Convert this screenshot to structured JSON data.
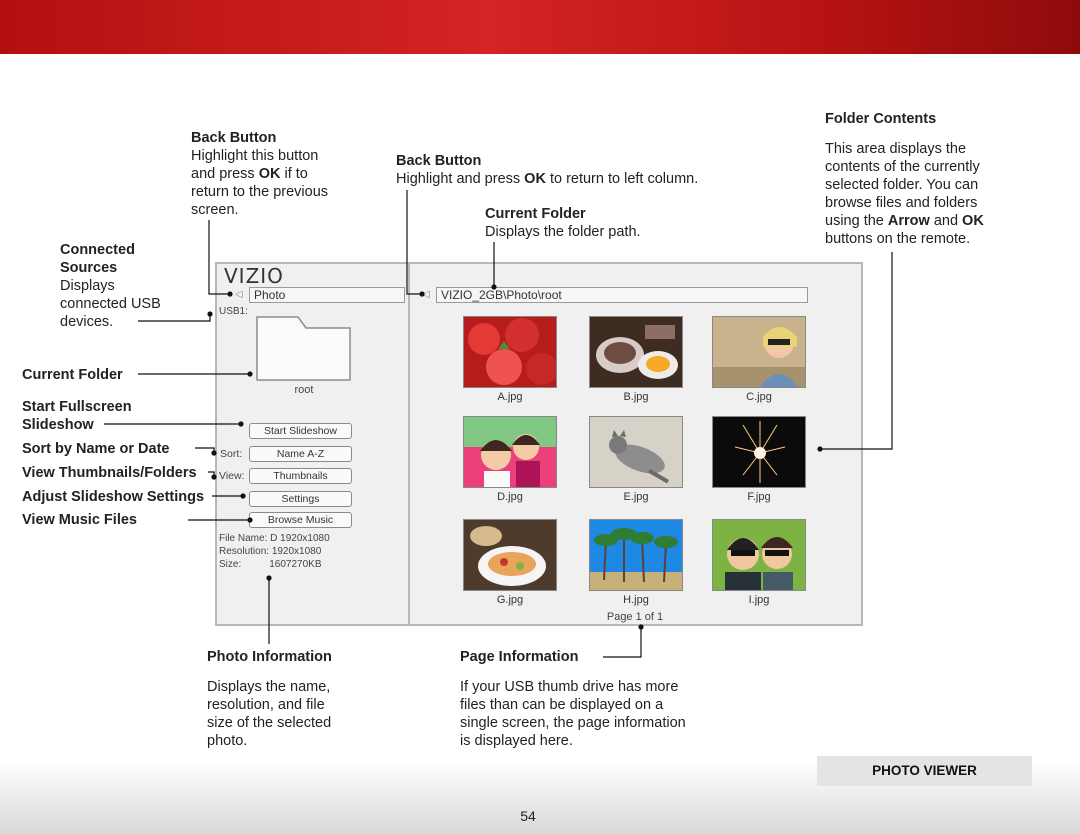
{
  "annotations": {
    "back_left": {
      "title": "Back Button",
      "t1": "Highlight this button",
      "t2a": "and press ",
      "t2b": "OK",
      "t2c": " if to",
      "t3": "return to the previous",
      "t4": "screen."
    },
    "back_right": {
      "title": "Back Button",
      "t1a": "Highlight and press ",
      "t1b": "OK",
      "t1c": " to return to left column."
    },
    "current_folder_right": {
      "title": "Current Folder",
      "t1": "Displays the folder path."
    },
    "folder_contents": {
      "title": "Folder Contents",
      "t1": "This area displays the",
      "t2": "contents of the currently",
      "t3": "selected folder. You can",
      "t4": "browse files and folders",
      "t5a": "using the ",
      "t5b": "Arrow",
      "t5c": " and ",
      "t5d": "OK",
      "t6": "buttons on the remote."
    },
    "connected": {
      "title1": "Connected",
      "title2": "Sources",
      "t1": "Displays",
      "t2": "connected USB",
      "t3": "devices."
    },
    "photo_info": {
      "title": "Photo Information",
      "t1": "Displays the name,",
      "t2": "resolution, and file",
      "t3": "size of the selected",
      "t4": "photo."
    },
    "page_info": {
      "title": "Page Information",
      "t1": "If your USB thumb drive has more",
      "t2": "files than can be displayed on a",
      "t3": "single screen, the page information",
      "t4": "is displayed here."
    }
  },
  "left_labels": {
    "current_folder": "Current Folder",
    "start_fullscreen_1": "Start Fullscreen",
    "start_fullscreen_2": "Slideshow",
    "sort": "Sort by Name or Date",
    "view": "View Thumbnails/Folders",
    "settings": "Adjust Slideshow Settings",
    "music": "View Music Files"
  },
  "screen": {
    "logo": "VIZIO",
    "left_path": "Photo",
    "right_path": "VIZIO_2GB\\Photo\\root",
    "usb_label": "USB1:",
    "folder_name": "root",
    "buttons": {
      "slideshow": "Start Slideshow",
      "sort_label": "Sort:",
      "sort_value": "Name A-Z",
      "view_label": "View:",
      "view_value": "Thumbnails",
      "settings": "Settings",
      "music": "Browse Music"
    },
    "file_info": {
      "name_label": "File Name:",
      "name_value": "D 1920x1080",
      "res_label": "Resolution:",
      "res_value": "1920x1080",
      "size_label": "Size:",
      "size_value": "1607270KB"
    },
    "thumbnails": [
      "A.jpg",
      "B.jpg",
      "C.jpg",
      "D.jpg",
      "E.jpg",
      "F.jpg",
      "G.jpg",
      "H.jpg",
      "I.jpg"
    ],
    "page": "Page 1 of 1"
  },
  "footer": {
    "section": "PHOTO VIEWER",
    "page_number": "54"
  }
}
